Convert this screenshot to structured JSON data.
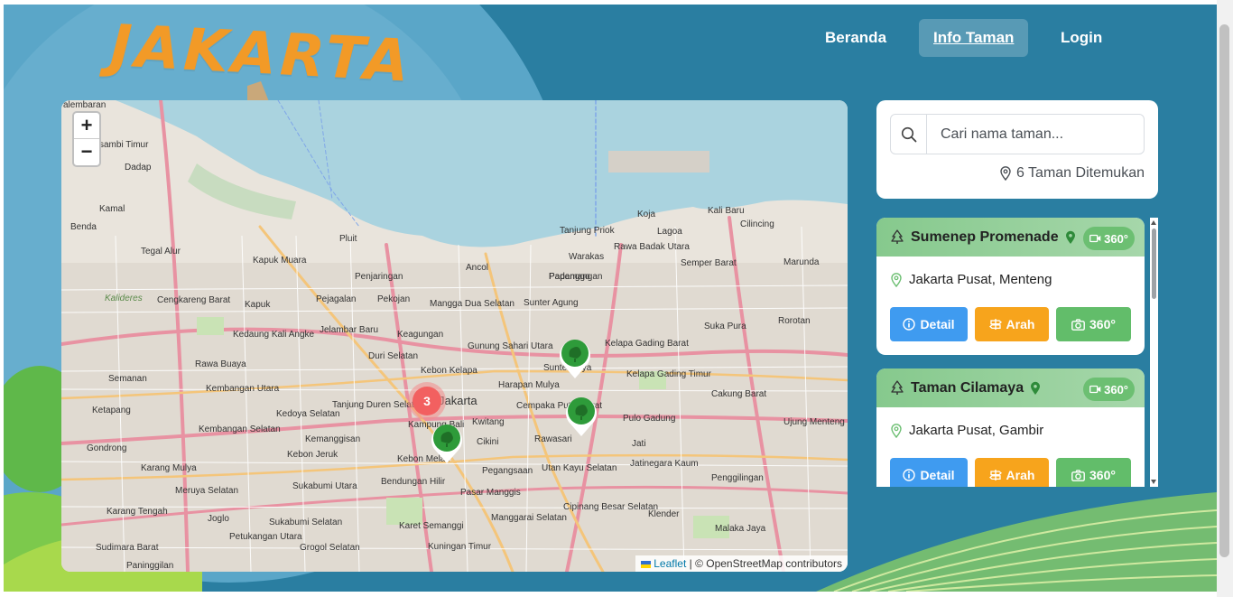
{
  "brand": {
    "logo_text": "JAKARTA",
    "color": "#f29a27"
  },
  "nav": {
    "items": [
      {
        "label": "Beranda",
        "active": false
      },
      {
        "label": "Info Taman",
        "active": true
      },
      {
        "label": "Login",
        "active": false
      }
    ]
  },
  "map": {
    "zoom_in": "+",
    "zoom_out": "−",
    "cluster_count": "3",
    "attribution": {
      "leaflet": "Leaflet",
      "osm": "© OpenStreetMap contributors"
    },
    "labels": [
      "alembaran",
      "sambi Timur",
      "Dadap",
      "Kamal",
      "Benda",
      "Tegal Alur",
      "Kalideres",
      "Cengkareng Barat",
      "Kedaung Kali Angke",
      "Rawa Buaya",
      "Semanan",
      "Kembangan Utara",
      "Ketapang",
      "Kembangan Selatan",
      "Gondrong",
      "Karang Mulya",
      "Meruya Selatan",
      "Karang Tengah",
      "Joglo",
      "Sukabumi Selatan",
      "Petukangan Utara",
      "Sudimara Barat",
      "Paninggilan",
      "Kapuk Muara",
      "Penjaringan",
      "Pluit",
      "Ancol",
      "Pademangan",
      "Tanjung Priok",
      "Rawa Badak Utara",
      "Koja",
      "Lagoa",
      "Kali Baru",
      "Cilincing",
      "Semper Barat",
      "Marunda",
      "Warakas",
      "Papanggo",
      "Sunter Agung",
      "Sunter Jaya",
      "Kelapa Gading Barat",
      "Kelapa Gading Timur",
      "Suka Pura",
      "Rorotan",
      "Cakung Barat",
      "Ujung Menteng",
      "Pulo Gadung",
      "Jati",
      "Jatinegara Kaum",
      "Penggilingan",
      "Klender",
      "Malaka Jaya",
      "Cipinang Besar Selatan",
      "Utan Kayu Selatan",
      "Rawasari",
      "Cempaka Putih Barat",
      "Harapan Mulya",
      "Gunung Sahari Utara",
      "Mangga Dua Selatan",
      "Kebon Kelapa",
      "Jakarta",
      "Kwitang",
      "Cikini",
      "Pegangsaan",
      "Pasar Manggis",
      "Manggarai Selatan",
      "Karet Semanggi",
      "Kuningan Timur",
      "Bendungan Hilir",
      "Kebon Melati",
      "Kampung Bali",
      "Tanjung Duren Selatan",
      "Kemanggisan",
      "Kebon Jeruk",
      "Kedoya Selatan",
      "Sukabumi Utara",
      "Grogol Selatan",
      "Duri Selatan",
      "Keagungan",
      "Pekojan",
      "Pejagalan",
      "Jelambar Baru",
      "Kapuk"
    ]
  },
  "search": {
    "placeholder": "Cari nama taman...",
    "count_text": "6 Taman Ditemukan"
  },
  "parks": [
    {
      "name": "Sumenep Promenade",
      "location": "Jakarta Pusat, Menteng",
      "badge": "360°",
      "detail_label": "Detail",
      "arah_label": "Arah",
      "view360_label": "360°"
    },
    {
      "name": "Taman Cilamaya",
      "location": "Jakarta Pusat, Gambir",
      "badge": "360°",
      "detail_label": "Detail",
      "arah_label": "Arah",
      "view360_label": "360°"
    }
  ],
  "colors": {
    "page_bg": "#2a7ea1",
    "park_header": "#86c98d",
    "detail": "#3f9bf0",
    "arah": "#f7a41c",
    "view360": "#62bd6a",
    "cluster": "#f26060",
    "marker": "#2e9b3a"
  }
}
